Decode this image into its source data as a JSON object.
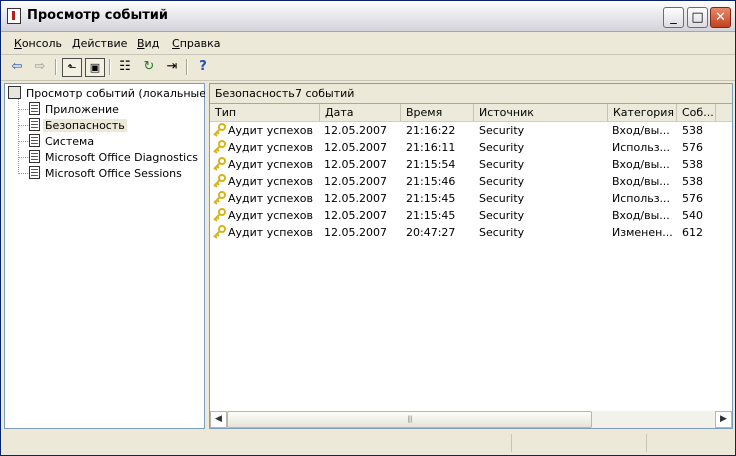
{
  "window": {
    "title": "Просмотр событий",
    "minimize": "_",
    "maximize": "□",
    "close": "✕"
  },
  "menu": {
    "items": [
      {
        "first": "К",
        "rest": "онсоль"
      },
      {
        "first": "Д",
        "rest": "ействие"
      },
      {
        "first": "В",
        "rest": "ид"
      },
      {
        "first": "С",
        "rest": "правка"
      }
    ]
  },
  "toolbar": {
    "icons": [
      "back-arrow-icon",
      "forward-arrow-icon",
      "up-folder-icon",
      "show-hide-tree-icon",
      "properties-icon",
      "refresh-icon",
      "export-list-icon",
      "help-icon"
    ],
    "glyphs": [
      "⇦",
      "⇨",
      "⬑",
      "▣",
      "☷",
      "↻",
      "⇥",
      "?"
    ]
  },
  "tree": {
    "root": "Просмотр событий (локальные)",
    "items": [
      {
        "label": "Приложение",
        "selected": false
      },
      {
        "label": "Безопасность",
        "selected": true
      },
      {
        "label": "Система",
        "selected": false
      },
      {
        "label": "Microsoft Office Diagnostics",
        "selected": false
      },
      {
        "label": "Microsoft Office Sessions",
        "selected": false
      }
    ]
  },
  "list": {
    "log_name": "Безопасность",
    "count_text": "7 событий",
    "columns": [
      "Тип",
      "Дата",
      "Время",
      "Источник",
      "Категория",
      "Соб..."
    ],
    "rows": [
      [
        "Аудит успехов",
        "12.05.2007",
        "21:16:22",
        "Security",
        "Вход/вы...",
        "538"
      ],
      [
        "Аудит успехов",
        "12.05.2007",
        "21:16:11",
        "Security",
        "Использ...",
        "576"
      ],
      [
        "Аудит успехов",
        "12.05.2007",
        "21:15:54",
        "Security",
        "Вход/вы...",
        "538"
      ],
      [
        "Аудит успехов",
        "12.05.2007",
        "21:15:46",
        "Security",
        "Вход/вы...",
        "538"
      ],
      [
        "Аудит успехов",
        "12.05.2007",
        "21:15:45",
        "Security",
        "Использ...",
        "576"
      ],
      [
        "Аудит успехов",
        "12.05.2007",
        "21:15:45",
        "Security",
        "Вход/вы...",
        "540"
      ],
      [
        "Аудит успехов",
        "12.05.2007",
        "20:47:27",
        "Security",
        "Изменен...",
        "612"
      ]
    ]
  },
  "scrollbar": {
    "left": "◀",
    "right": "▶",
    "grip": "|||"
  },
  "colors": {
    "title_bar_light": "#ffffff",
    "title_bar_dark": "#d4d3da",
    "close_button": "#c2411f",
    "window_bg": "#ece9d8",
    "key_icon": "#d6b418"
  }
}
